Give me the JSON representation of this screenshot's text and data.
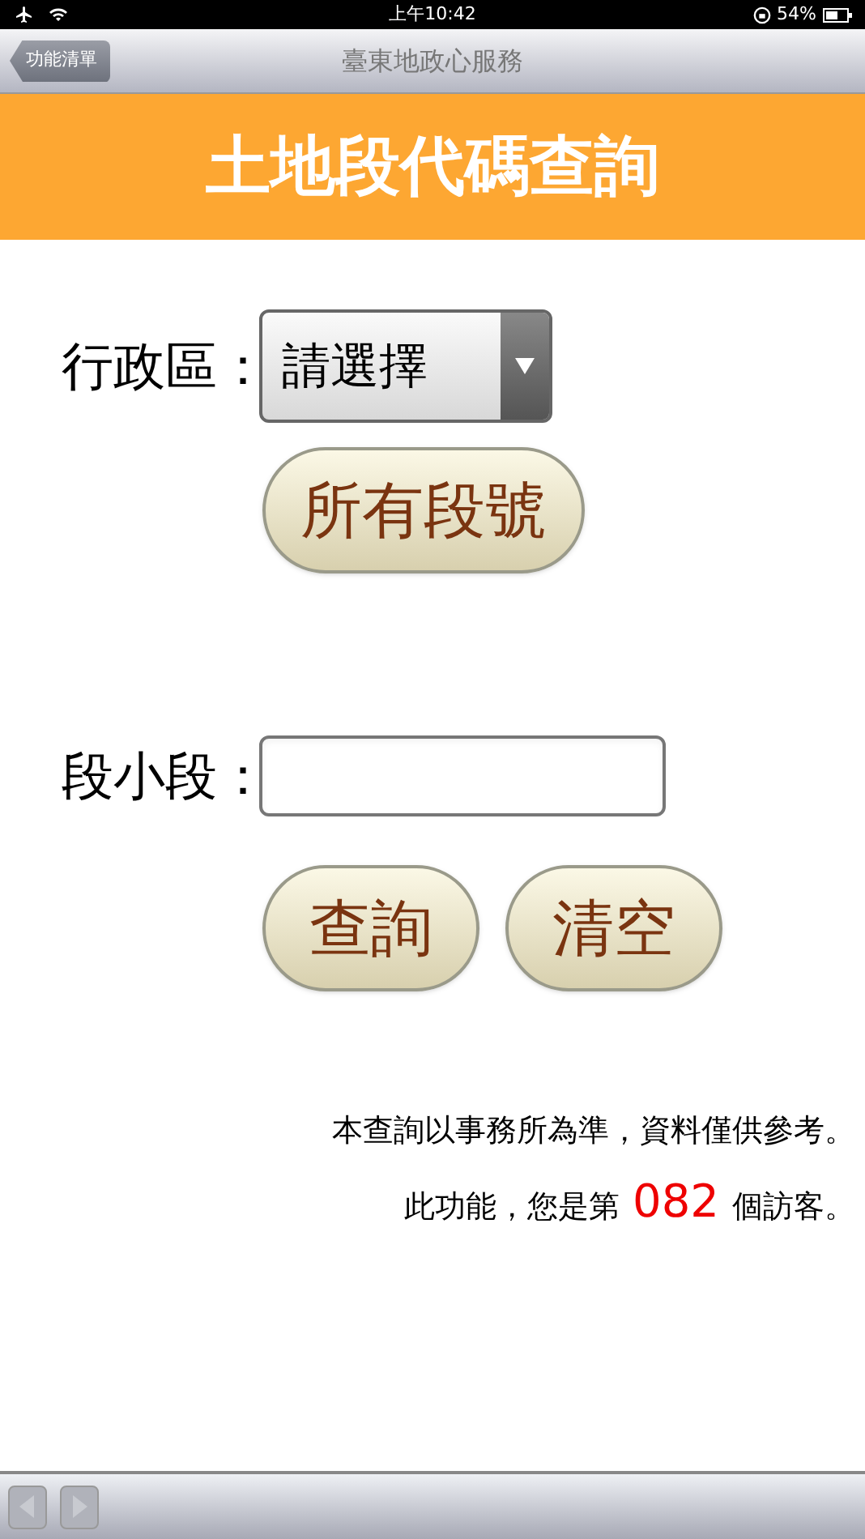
{
  "status_bar": {
    "time": "上午10:42",
    "battery": "54%"
  },
  "nav_bar": {
    "back": "功能清單",
    "title": "臺東地政心服務"
  },
  "header": {
    "title": "土地段代碼查詢"
  },
  "district": {
    "label": "行政區：",
    "value": "請選擇"
  },
  "all_button": "所有段號",
  "section": {
    "label": "段小段："
  },
  "buttons": [
    "查詢",
    "清空"
  ],
  "notes": {
    "line1": "本查詢以事務所為準，資料僅供參考。",
    "prefix": "此功能，您是第",
    "count": "082",
    "suffix": "個訪客。"
  },
  "toolbar": [
    {
      "kind": "back",
      "disabled": true
    },
    {
      "kind": "forward",
      "disabled": true
    }
  ]
}
